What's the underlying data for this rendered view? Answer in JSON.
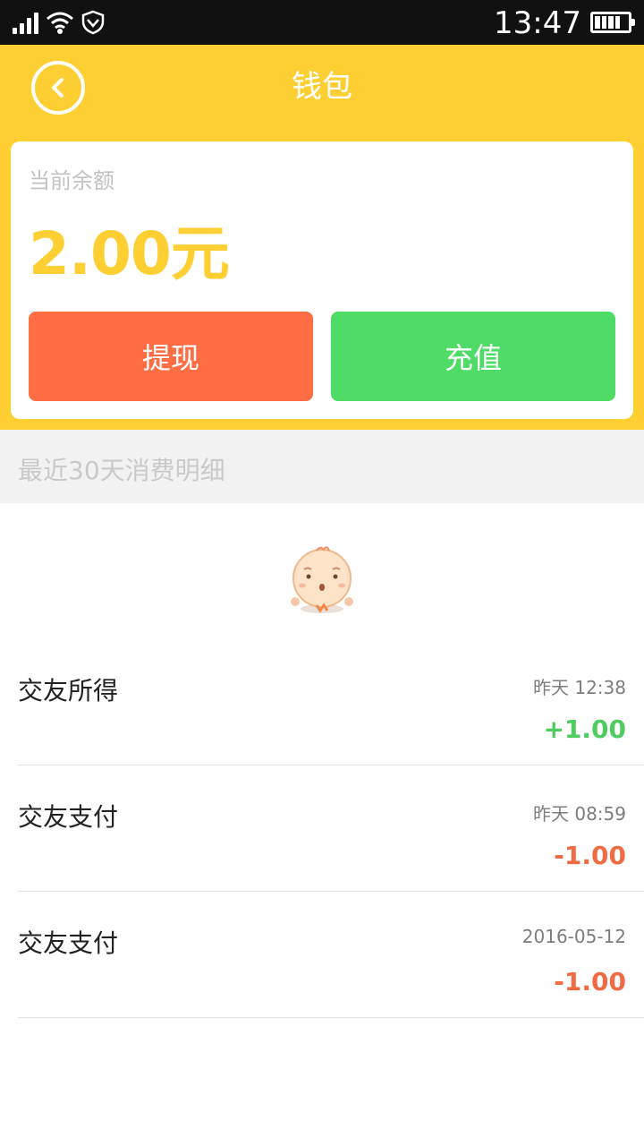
{
  "status_bar": {
    "time": "13:47",
    "icons": [
      "signal-icon",
      "wifi-icon",
      "shield-icon",
      "battery-icon"
    ]
  },
  "header": {
    "title": "钱包",
    "back_icon": "chevron-left-icon",
    "background": "#fecf33"
  },
  "balance": {
    "label": "当前余额",
    "value": "2.00元",
    "withdraw_label": "提现",
    "recharge_label": "充值",
    "withdraw_color": "#ff6d45",
    "recharge_color": "#4fdc66"
  },
  "section": {
    "title": "最近30天消费明细"
  },
  "transactions": [
    {
      "title": "交友所得",
      "time": "昨天 12:38",
      "amount": "+1.00",
      "type": "income"
    },
    {
      "title": "交友支付",
      "time": "昨天 08:59",
      "amount": "-1.00",
      "type": "expense"
    },
    {
      "title": "交友支付",
      "time": "2016-05-12",
      "amount": "-1.00",
      "type": "expense"
    }
  ]
}
